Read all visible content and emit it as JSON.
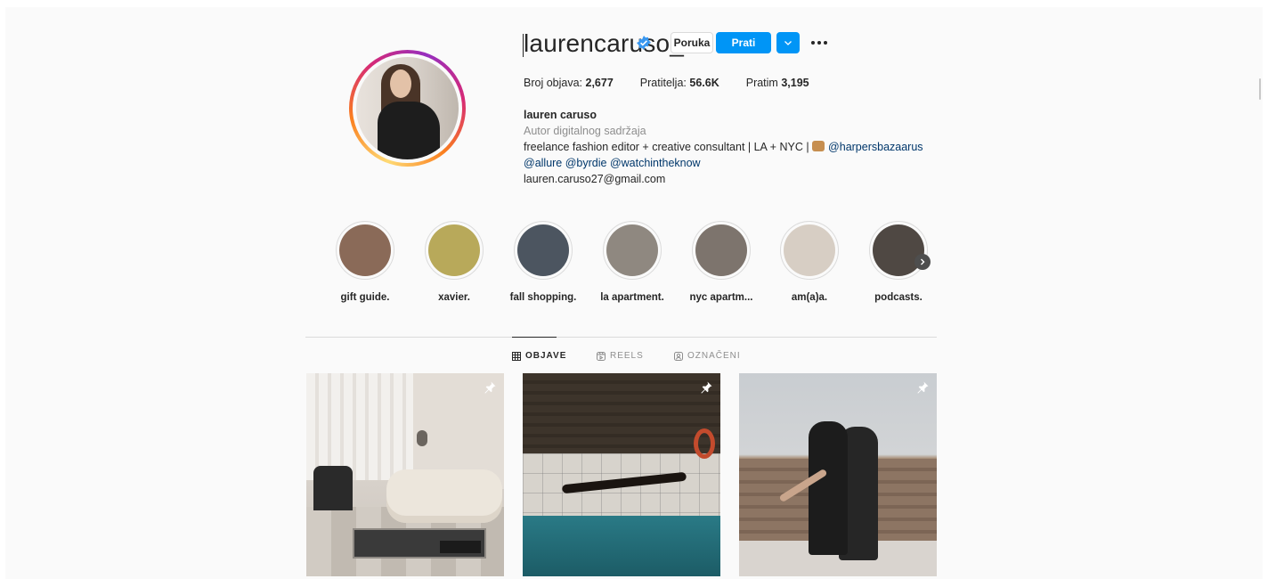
{
  "profile": {
    "username": "laurencaruso_",
    "verified": true,
    "message_label": "Poruka",
    "follow_label": "Prati",
    "stats": {
      "posts_label": "Broj objava:",
      "posts_value": "2,677",
      "followers_label": "Pratitelja:",
      "followers_value": "56.6K",
      "following_label": "Pratim",
      "following_value": "3,195"
    },
    "bio": {
      "name": "lauren caruso",
      "category": "Autor digitalnog sadržaja",
      "line1": "freelance fashion editor + creative consultant | LA + NYC | ",
      "line1_link": "@harpersbazaarus",
      "line2": "@allure @byrdie @watchintheknow",
      "email": "lauren.caruso27@gmail.com"
    }
  },
  "highlights": [
    {
      "label": "gift guide.",
      "color": "#8a6a58"
    },
    {
      "label": "xavier.",
      "color": "#b8a95a"
    },
    {
      "label": "fall shopping.",
      "color": "#4c5560"
    },
    {
      "label": "la apartment.",
      "color": "#8f8880"
    },
    {
      "label": "nyc apartm...",
      "color": "#7d746d"
    },
    {
      "label": "am(a)a.",
      "color": "#d7cec4"
    },
    {
      "label": "podcasts.",
      "color": "#4f4843"
    }
  ],
  "tabs": {
    "posts": "OBJAVE",
    "reels": "REELS",
    "tagged": "OZNAČENI"
  },
  "colors": {
    "accent": "#0095f6",
    "link": "#00376b",
    "muted": "#8e8e8e",
    "text": "#262626"
  }
}
